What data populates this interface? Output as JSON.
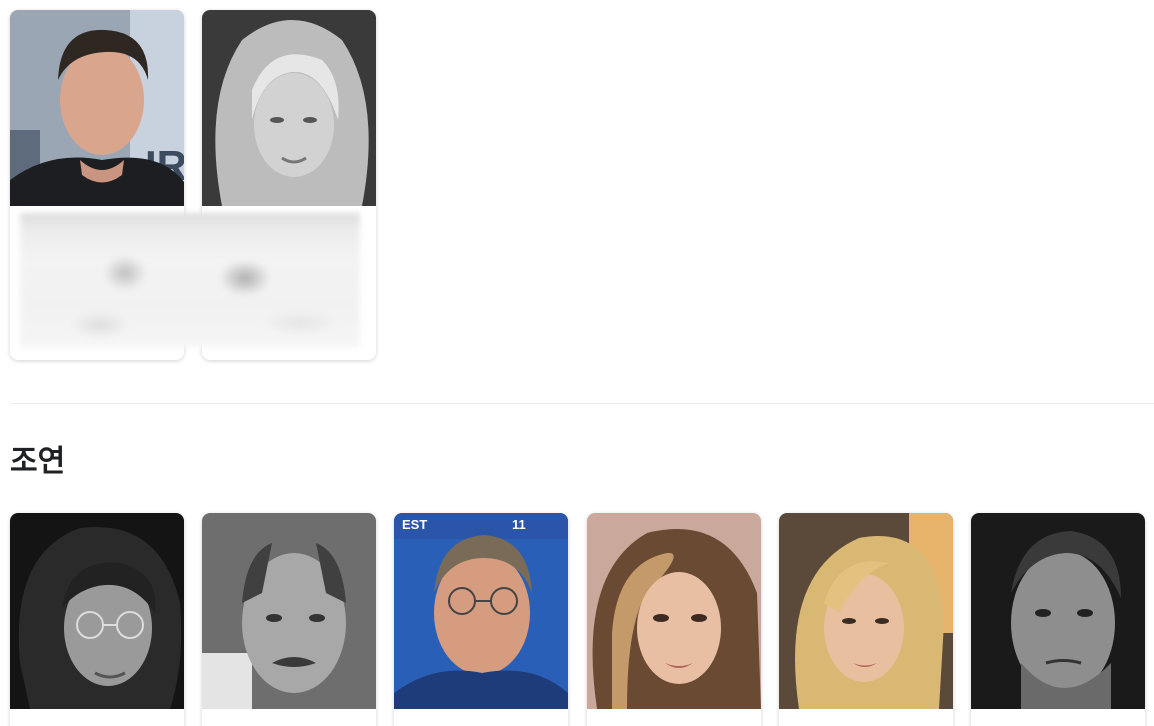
{
  "supporting_cast_section": {
    "title": "조연"
  },
  "top_cards": [
    {
      "photo": "man-portrait-photo"
    },
    {
      "photo": "woman-bw-portrait-photo"
    }
  ],
  "cast_cards": [
    {
      "photo": "curly-hair-glasses-man-bw-photo"
    },
    {
      "photo": "mustache-man-bw-photo"
    },
    {
      "photo": "glasses-man-blue-background-photo"
    },
    {
      "photo": "brunette-woman-photo"
    },
    {
      "photo": "blonde-woman-photo"
    },
    {
      "photo": "bearded-man-bw-photo"
    }
  ]
}
